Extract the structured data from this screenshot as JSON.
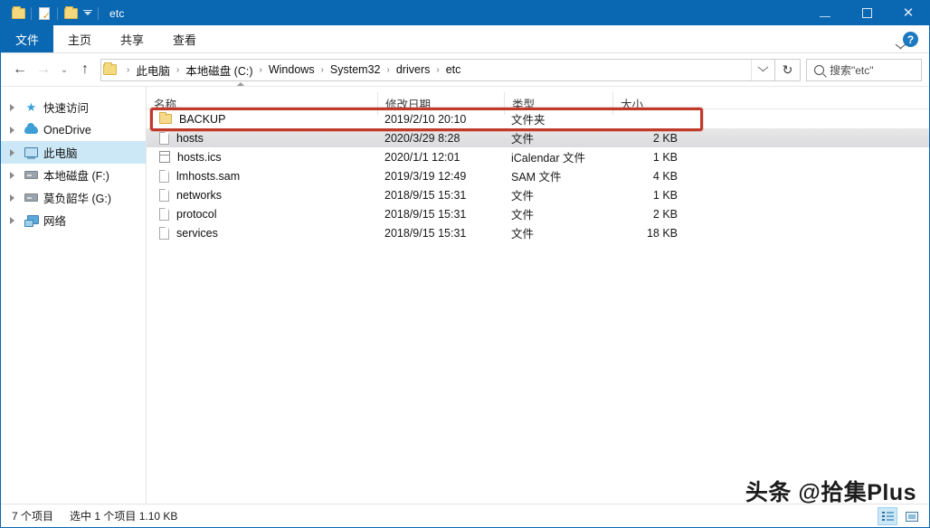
{
  "window": {
    "title": "etc",
    "quick_access": [
      "folder-icon",
      "properties-icon",
      "new-folder-icon",
      "customize-chevron-icon"
    ],
    "controls": {
      "minimize": "minimize-icon",
      "maximize": "maximize-icon",
      "close": "close-icon"
    }
  },
  "ribbon": {
    "tabs": [
      {
        "label": "文件",
        "active": true
      },
      {
        "label": "主页",
        "active": false
      },
      {
        "label": "共享",
        "active": false
      },
      {
        "label": "查看",
        "active": false
      }
    ],
    "expand_label": "chevron-down-icon",
    "help_label": "?"
  },
  "address": {
    "back": "←",
    "forward": "→",
    "recent": "⌄",
    "up": "↑",
    "crumbs": [
      "此电脑",
      "本地磁盘 (C:)",
      "Windows",
      "System32",
      "drivers",
      "etc"
    ],
    "separator": "›",
    "dropdown": "chevron-down-icon",
    "refresh": "↻"
  },
  "search": {
    "placeholder": "搜索\"etc\"",
    "value": ""
  },
  "sidebar": {
    "items": [
      {
        "label": "快速访问",
        "icon": "star-icon",
        "selected": false
      },
      {
        "label": "OneDrive",
        "icon": "cloud-icon",
        "selected": false
      },
      {
        "label": "此电脑",
        "icon": "computer-icon",
        "selected": true
      },
      {
        "label": "本地磁盘 (F:)",
        "icon": "drive-icon",
        "selected": false
      },
      {
        "label": "莫负韶华 (G:)",
        "icon": "drive-icon",
        "selected": false
      },
      {
        "label": "网络",
        "icon": "network-icon",
        "selected": false
      }
    ]
  },
  "filelist": {
    "columns": [
      {
        "label": "名称",
        "sorted": true
      },
      {
        "label": "修改日期",
        "sorted": false
      },
      {
        "label": "类型",
        "sorted": false
      },
      {
        "label": "大小",
        "sorted": false
      }
    ],
    "rows": [
      {
        "name": "BACKUP",
        "date": "2019/2/10 20:10",
        "type": "文件夹",
        "size": "",
        "icon": "folder-icon",
        "selected": false
      },
      {
        "name": "hosts",
        "date": "2020/3/29 8:28",
        "type": "文件",
        "size": "2 KB",
        "icon": "file-icon",
        "selected": true
      },
      {
        "name": "hosts.ics",
        "date": "2020/1/1 12:01",
        "type": "iCalendar 文件",
        "size": "1 KB",
        "icon": "calendar-file-icon",
        "selected": false
      },
      {
        "name": "lmhosts.sam",
        "date": "2019/3/19 12:49",
        "type": "SAM 文件",
        "size": "4 KB",
        "icon": "file-icon",
        "selected": false
      },
      {
        "name": "networks",
        "date": "2018/9/15 15:31",
        "type": "文件",
        "size": "1 KB",
        "icon": "file-icon",
        "selected": false
      },
      {
        "name": "protocol",
        "date": "2018/9/15 15:31",
        "type": "文件",
        "size": "2 KB",
        "icon": "file-icon",
        "selected": false
      },
      {
        "name": "services",
        "date": "2018/9/15 15:31",
        "type": "文件",
        "size": "18 KB",
        "icon": "file-icon",
        "selected": false
      }
    ],
    "highlight_color": "#c0392b"
  },
  "statusbar": {
    "item_count": "7 个项目",
    "selection": "选中 1 个项目  1.10 KB",
    "views": [
      {
        "name": "details-view",
        "active": true
      },
      {
        "name": "large-icons-view",
        "active": false
      }
    ]
  },
  "watermark": {
    "text": "头条 @拾集Plus"
  },
  "colors": {
    "titlebar": "#0a67b2",
    "tab_active": "#0a67b2",
    "sidebar_selection": "#cce8f7",
    "row_selection": "#e0e0e2",
    "annotation": "#c0392b"
  }
}
